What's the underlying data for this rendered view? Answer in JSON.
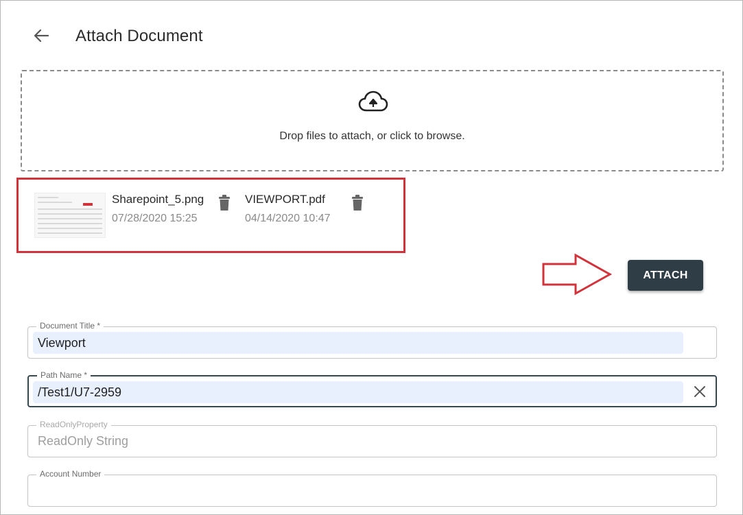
{
  "header": {
    "title": "Attach Document",
    "back_icon": "arrow-left-icon"
  },
  "dropzone": {
    "icon": "cloud-upload-icon",
    "text": "Drop files to attach, or click to browse."
  },
  "files": [
    {
      "name": "Sharepoint_5.png",
      "date": "07/28/2020 15:25",
      "has_thumbnail": true
    },
    {
      "name": "VIEWPORT.pdf",
      "date": "04/14/2020 10:47",
      "has_thumbnail": false
    }
  ],
  "actions": {
    "attach_label": "ATTACH"
  },
  "fields": {
    "document_title": {
      "label": "Document Title *",
      "value": "Viewport"
    },
    "path_name": {
      "label": "Path Name *",
      "value": "/Test1/U7-2959"
    },
    "readonly_property": {
      "label": "ReadOnlyProperty",
      "value": "ReadOnly String"
    },
    "account_number": {
      "label": "Account Number",
      "value": ""
    }
  },
  "colors": {
    "primary_button": "#2f3e46",
    "highlight_red": "#d2323a",
    "autofill_bg": "#e8f0fe"
  }
}
